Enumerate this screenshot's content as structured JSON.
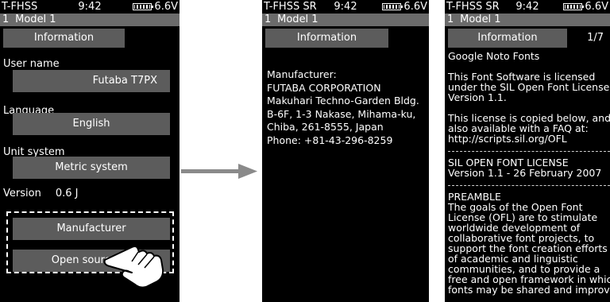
{
  "status": {
    "protocol_main": "T-FHSS",
    "protocol_sr": "T-FHSS SR",
    "time": "9:42",
    "voltage": "6.6V"
  },
  "model": {
    "number": "1",
    "name": "Model 1"
  },
  "screen1": {
    "title": "Information",
    "user_name_label": "User name",
    "user_name_value": "Futaba T7PX",
    "language_label": "Language",
    "language_value": "English",
    "unit_label": "Unit system",
    "unit_value": "Metric system",
    "version_label": "Version",
    "version_value": "0.6 J",
    "manufacturer_button": "Manufacturer",
    "open_source_button": "Open source lic"
  },
  "screen2": {
    "title": "Information",
    "lines": [
      "Manufacturer:",
      "FUTABA CORPORATION",
      "Makuhari Techno-Garden Bldg.",
      "B-6F, 1-3 Nakase, Mihama-ku,",
      "Chiba, 261-8555, Japan",
      "Phone: +81-43-296-8259"
    ]
  },
  "screen3": {
    "title": "Information",
    "page": "1/7",
    "heading": "Google Noto Fonts",
    "para1": [
      "This Font Software is licensed",
      "under the SIL Open Font License,",
      "Version 1.1."
    ],
    "para2": [
      "This license is copied below, and is",
      "also available with a FAQ at:",
      "http://scripts.sil.org/OFL"
    ],
    "ofl": [
      "SIL OPEN FONT LICENSE",
      "Version 1.1 - 26 February 2007"
    ],
    "preamble": [
      "PREAMBLE",
      "The goals of the Open Font",
      "License (OFL) are to stimulate",
      "worldwide development of",
      "collaborative font projects, to",
      "support the font creation efforts",
      "of academic and linguistic",
      "communities, and to provide a",
      "free and open framework in which",
      "fonts may be shared and improved"
    ]
  },
  "icons": {
    "battery": "battery-icon",
    "hand": "hand-pointer-icon",
    "arrow": "arrow-right-icon"
  },
  "colors": {
    "screen_bg": "#000000",
    "bar_gray": "#6b6b6b",
    "button_gray": "#5c5c5c",
    "arrow_gray": "#8a8a8a"
  }
}
